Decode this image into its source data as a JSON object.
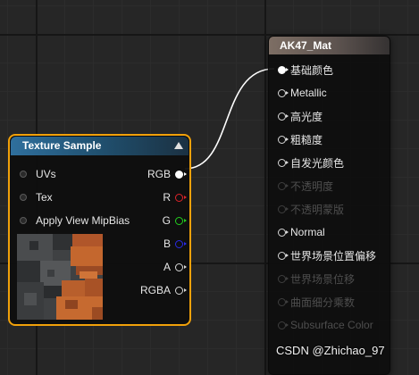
{
  "material_node": {
    "title": "AK47_Mat",
    "pins": [
      {
        "label": "基础颜色",
        "enabled": true,
        "connected": true
      },
      {
        "label": "Metallic",
        "enabled": true,
        "connected": false
      },
      {
        "label": "高光度",
        "enabled": true,
        "connected": false
      },
      {
        "label": "粗糙度",
        "enabled": true,
        "connected": false
      },
      {
        "label": "自发光颜色",
        "enabled": true,
        "connected": false
      },
      {
        "label": "不透明度",
        "enabled": false,
        "connected": false
      },
      {
        "label": "不透明蒙版",
        "enabled": false,
        "connected": false
      },
      {
        "label": "Normal",
        "enabled": true,
        "connected": false
      },
      {
        "label": "世界场景位置偏移",
        "enabled": true,
        "connected": false
      },
      {
        "label": "世界场景位移",
        "enabled": false,
        "connected": false
      },
      {
        "label": "曲面细分乘数",
        "enabled": false,
        "connected": false
      },
      {
        "label": "Subsurface Color",
        "enabled": false,
        "connected": false
      }
    ]
  },
  "texture_node": {
    "title": "Texture Sample",
    "inputs": [
      "UVs",
      "Tex",
      "Apply View MipBias"
    ],
    "outputs": [
      {
        "label": "RGB",
        "color": "#ffffff",
        "connected": true
      },
      {
        "label": "R",
        "color": "#e0242a",
        "connected": false
      },
      {
        "label": "G",
        "color": "#23d11f",
        "connected": false
      },
      {
        "label": "B",
        "color": "#2a2ae6",
        "connected": false
      },
      {
        "label": "A",
        "color": "#d8d8d8",
        "connected": false
      },
      {
        "label": "RGBA",
        "color": "#d8d8d8",
        "connected": false
      }
    ]
  },
  "colors": {
    "selection_outline": "#f1a10a",
    "texture_header": "#2f6f9d",
    "material_header": "#7d6e64",
    "wire": "#ffffff"
  },
  "watermark": "CSDN @Zhichao_97"
}
